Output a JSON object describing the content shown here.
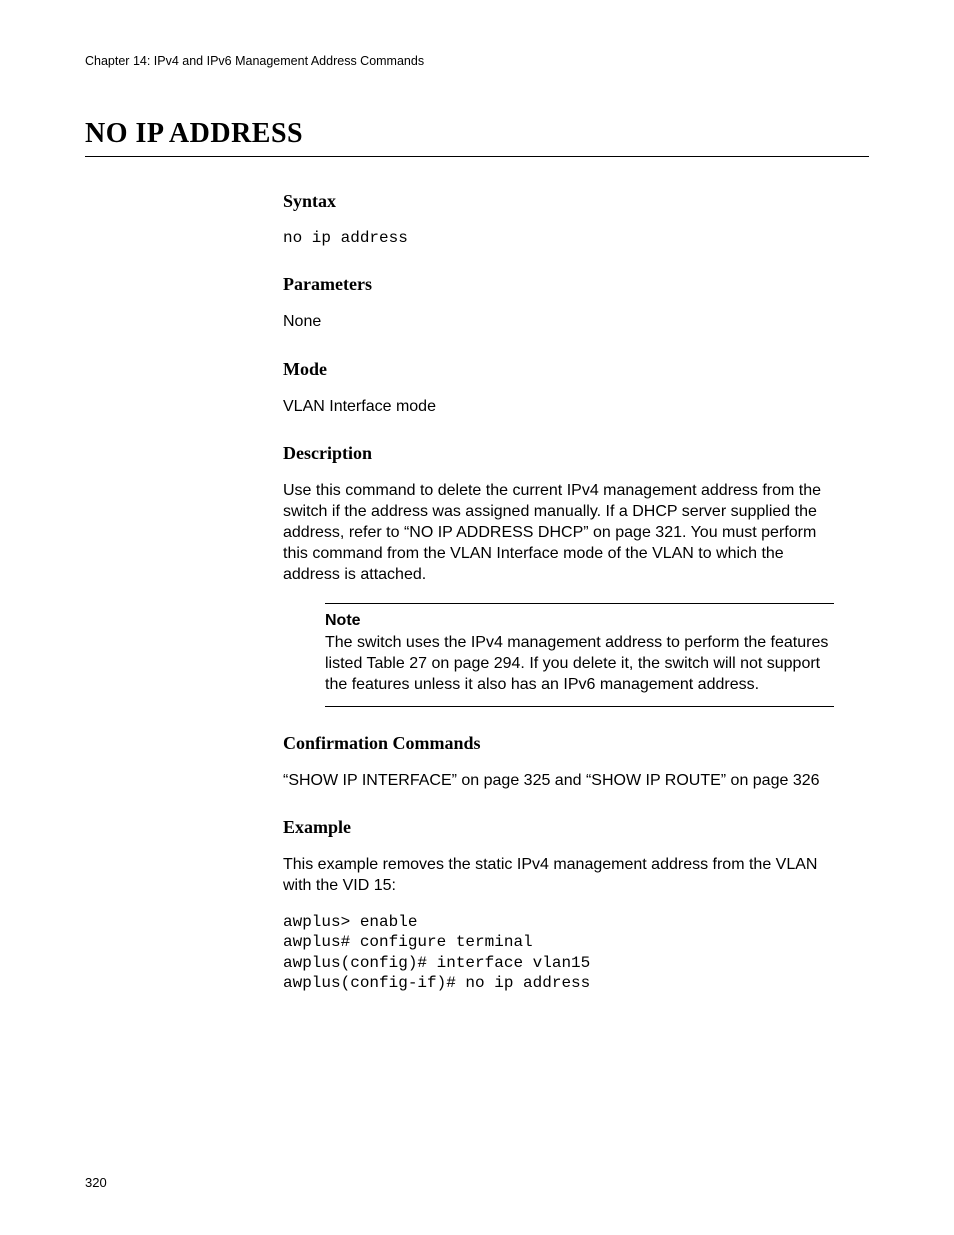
{
  "header": {
    "chapter": "Chapter 14: IPv4 and IPv6 Management Address Commands"
  },
  "title": "NO IP ADDRESS",
  "sections": {
    "syntax": {
      "heading": "Syntax",
      "code": "no ip address"
    },
    "parameters": {
      "heading": "Parameters",
      "text": "None"
    },
    "mode": {
      "heading": "Mode",
      "text": "VLAN Interface mode"
    },
    "description": {
      "heading": "Description",
      "text": "Use this command to delete the current IPv4 management address from the switch if the address was assigned manually. If a DHCP server supplied the address, refer to “NO IP ADDRESS DHCP” on page 321. You must perform this command from the VLAN Interface mode of the VLAN to which the address is attached.",
      "note_label": "Note",
      "note_text": "The switch uses the IPv4 management address to perform the features listed Table 27 on page 294. If you delete it, the switch will not support the features unless it also has an IPv6 management address."
    },
    "confirmation": {
      "heading": "Confirmation Commands",
      "text": "“SHOW IP INTERFACE” on page 325 and “SHOW IP ROUTE” on page 326"
    },
    "example": {
      "heading": "Example",
      "intro": "This example removes the static IPv4 management address from the VLAN with the VID 15:",
      "code": "awplus> enable\nawplus# configure terminal\nawplus(config)# interface vlan15\nawplus(config-if)# no ip address"
    }
  },
  "page_number": "320"
}
